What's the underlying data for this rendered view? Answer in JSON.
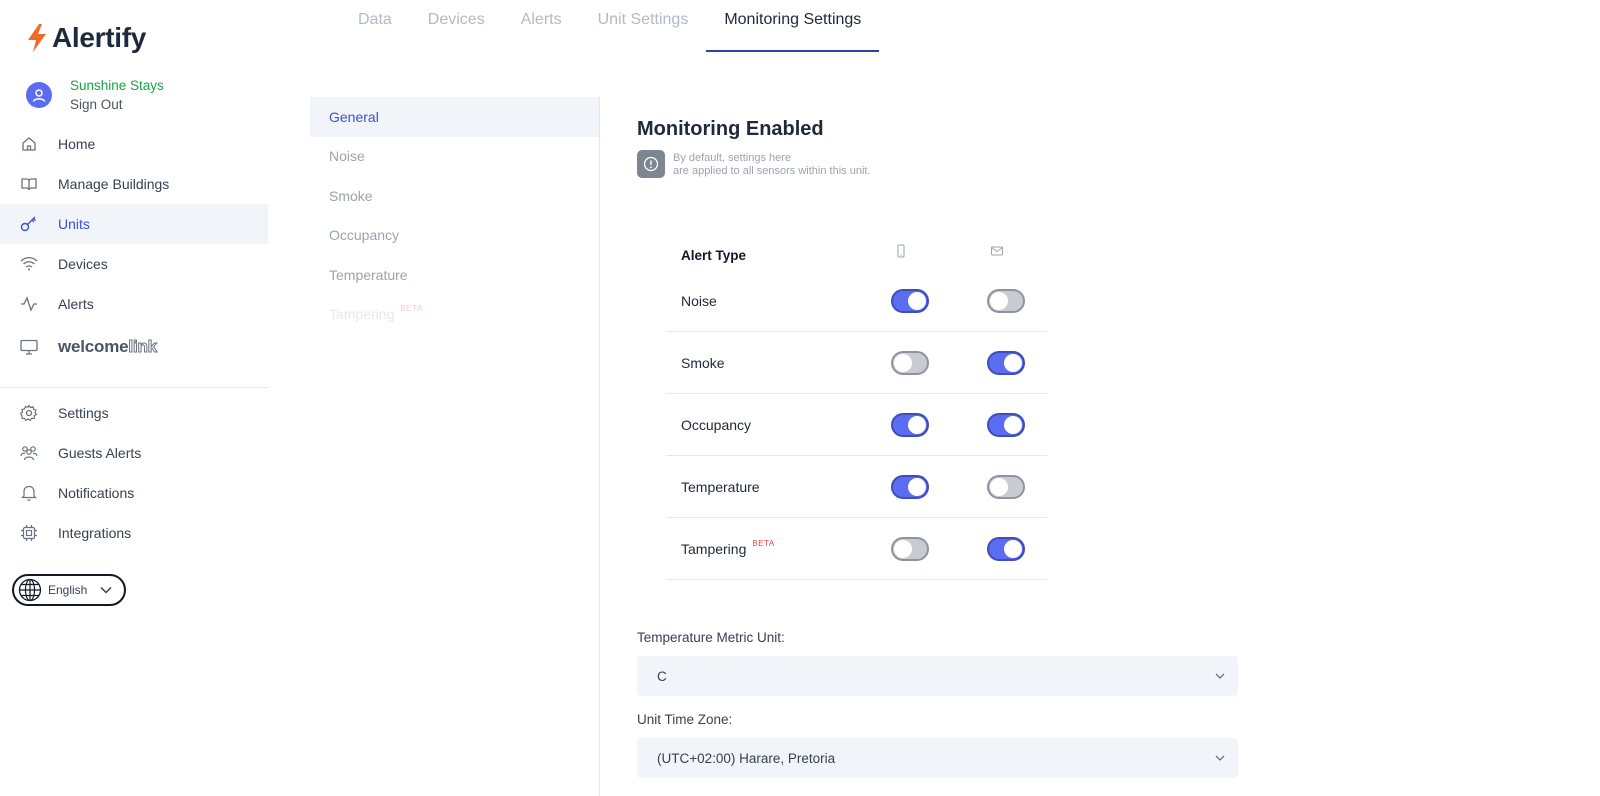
{
  "app": {
    "name": "Alertify",
    "brand_color": "#f26b2a",
    "accent": "#5b6cf0"
  },
  "user": {
    "name": "Sunshine Stays",
    "sign_out": "Sign Out"
  },
  "sidebar": {
    "items": [
      {
        "label": "Home",
        "icon": "home-icon"
      },
      {
        "label": "Manage Buildings",
        "icon": "book-icon"
      },
      {
        "label": "Units",
        "icon": "key-icon",
        "active": true
      },
      {
        "label": "Devices",
        "icon": "wifi-icon"
      },
      {
        "label": "Alerts",
        "icon": "activity-icon"
      },
      {
        "label_a": "welcome",
        "label_b": "link",
        "icon": "monitor-icon"
      }
    ],
    "bottom_items": [
      {
        "label": "Settings",
        "icon": "gear-icon"
      },
      {
        "label": "Guests Alerts",
        "icon": "users-icon"
      },
      {
        "label": "Notifications",
        "icon": "bell-icon"
      },
      {
        "label": "Integrations",
        "icon": "chip-icon"
      }
    ],
    "language": "English"
  },
  "tabs": [
    {
      "label": "Data"
    },
    {
      "label": "Devices"
    },
    {
      "label": "Alerts"
    },
    {
      "label": "Unit Settings"
    },
    {
      "label": "Monitoring Settings",
      "active": true
    }
  ],
  "subnav": {
    "items": [
      {
        "label": "General",
        "active": true
      },
      {
        "label": "Noise"
      },
      {
        "label": "Smoke"
      },
      {
        "label": "Occupancy"
      },
      {
        "label": "Temperature"
      },
      {
        "label": "Tampering",
        "badge": "BETA",
        "disabled": true
      }
    ]
  },
  "main": {
    "heading": "Monitoring Enabled",
    "info": {
      "line1": "By default, settings here",
      "line2": "are applied to all sensors within this unit."
    },
    "alert_table": {
      "header": "Alert Type",
      "columns": [
        "phone-icon",
        "mail-icon"
      ],
      "rows": [
        {
          "label": "Noise",
          "push": true,
          "email": false
        },
        {
          "label": "Smoke",
          "push": false,
          "email": true
        },
        {
          "label": "Occupancy",
          "push": true,
          "email": true
        },
        {
          "label": "Temperature",
          "push": true,
          "email": false
        },
        {
          "label": "Tampering",
          "badge": "BETA",
          "push": false,
          "email": true
        }
      ]
    },
    "temperature_unit": {
      "label": "Temperature Metric Unit:",
      "value": "C"
    },
    "time_zone": {
      "label": "Unit Time Zone:",
      "value": "(UTC+02:00) Harare, Pretoria"
    }
  }
}
